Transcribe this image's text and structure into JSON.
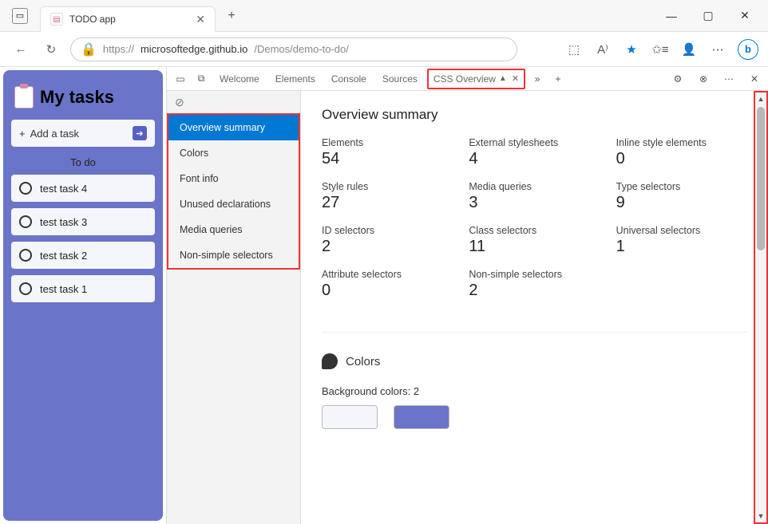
{
  "browser": {
    "tab_title": "TODO app",
    "url_host": "microsoftedge.github.io",
    "url_prefix": "https://",
    "url_path": "/Demos/demo-to-do/"
  },
  "todo": {
    "title": "My tasks",
    "add_label": "Add a task",
    "section_label": "To do",
    "tasks": [
      "test task 4",
      "test task 3",
      "test task 2",
      "test task 1"
    ]
  },
  "devtools": {
    "tabs": [
      "Welcome",
      "Elements",
      "Console",
      "Sources",
      "CSS Overview"
    ],
    "active_tab": "CSS Overview",
    "sidebar": [
      "Overview summary",
      "Colors",
      "Font info",
      "Unused declarations",
      "Media queries",
      "Non-simple selectors"
    ],
    "sidebar_selected": "Overview summary",
    "overview": {
      "title": "Overview summary",
      "stats": [
        {
          "label": "Elements",
          "value": "54"
        },
        {
          "label": "External stylesheets",
          "value": "4"
        },
        {
          "label": "Inline style elements",
          "value": "0"
        },
        {
          "label": "Style rules",
          "value": "27"
        },
        {
          "label": "Media queries",
          "value": "3"
        },
        {
          "label": "Type selectors",
          "value": "9"
        },
        {
          "label": "ID selectors",
          "value": "2"
        },
        {
          "label": "Class selectors",
          "value": "11"
        },
        {
          "label": "Universal selectors",
          "value": "1"
        },
        {
          "label": "Attribute selectors",
          "value": "0"
        },
        {
          "label": "Non-simple selectors",
          "value": "2"
        }
      ]
    },
    "colors": {
      "heading": "Colors",
      "bg_label": "Background colors: 2",
      "swatches": [
        "#f5f6fb",
        "#6a74c9"
      ]
    }
  }
}
